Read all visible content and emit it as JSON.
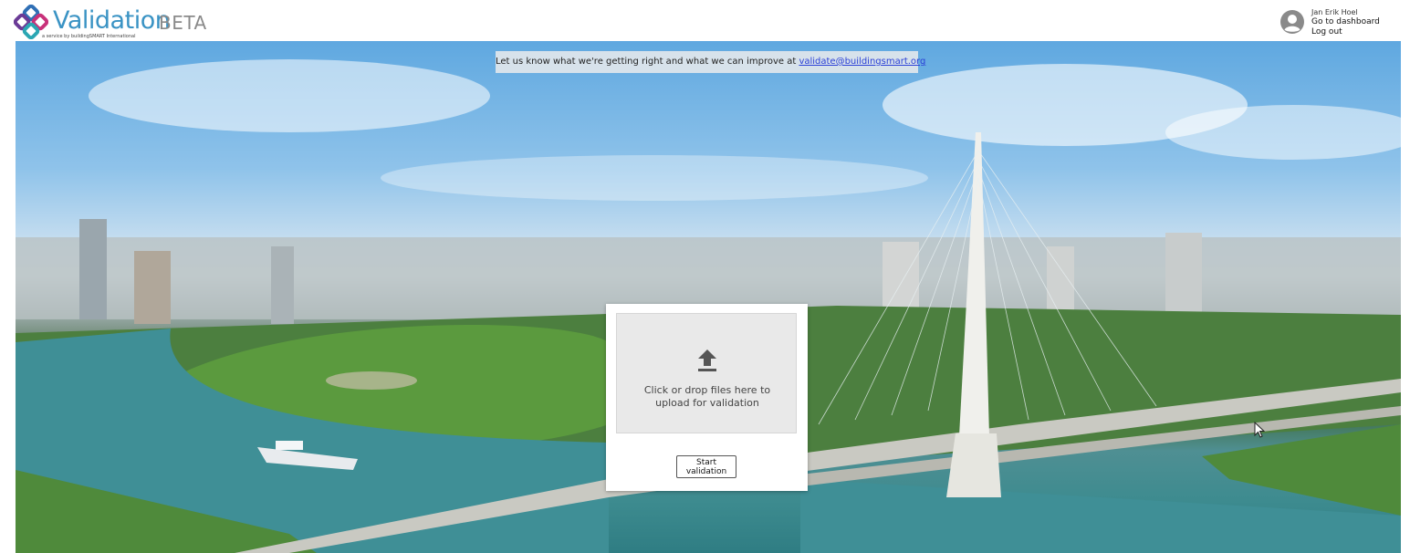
{
  "header": {
    "logo_text": "Validation",
    "logo_badge": "BETA",
    "logo_tagline": "a service by buildingSMART International",
    "colors": {
      "logo_blue": "#3a93c4",
      "badge_gray": "#8a8a8a"
    }
  },
  "user": {
    "name": "Jan Erik Hoel",
    "dashboard_link": "Go to dashboard",
    "logout_link": "Log out",
    "avatar_icon": "user-circle-icon"
  },
  "feedback": {
    "text": "Let us know what we're getting right and what we can improve at ",
    "email": "validate@buildingsmart.org"
  },
  "upload": {
    "icon": "upload-arrow-icon",
    "dropzone_text": "Click or drop files here to upload for validation",
    "start_button": "Start validation"
  },
  "colors": {
    "link": "#2a3fd6",
    "dropzone_bg": "#e9e9e9"
  }
}
